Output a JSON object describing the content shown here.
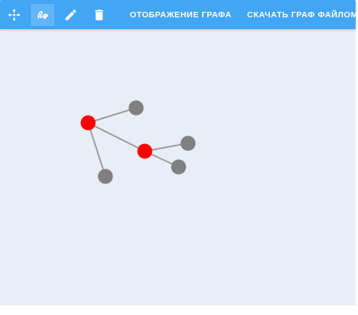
{
  "toolbar": {
    "tools": [
      {
        "icon": "move-icon",
        "active": false
      },
      {
        "icon": "draw-edge-icon",
        "active": true
      },
      {
        "icon": "pencil-icon",
        "active": false
      },
      {
        "icon": "trash-icon",
        "active": false
      }
    ],
    "show_graph_label": "ОТОБРАЖЕНИЕ ГРАФА",
    "download_label": "СКАЧАТЬ ГРАФ ФАЙЛОМ"
  },
  "colors": {
    "toolbar": "#42a5f5",
    "canvas": "#e9eef6",
    "node_selected": "#ff0000",
    "node_default": "#808080",
    "edge": "#9e9e9e"
  },
  "graph": {
    "nodes": [
      {
        "id": "n1",
        "color": "#ff0000"
      },
      {
        "id": "n2",
        "color": "#808080"
      },
      {
        "id": "n3",
        "color": "#808080"
      },
      {
        "id": "n4",
        "color": "#ff0000"
      },
      {
        "id": "n5",
        "color": "#808080"
      },
      {
        "id": "n6",
        "color": "#808080"
      }
    ],
    "edges": [
      {
        "from": "n1",
        "to": "n2"
      },
      {
        "from": "n1",
        "to": "n3"
      },
      {
        "from": "n1",
        "to": "n4"
      },
      {
        "from": "n4",
        "to": "n5"
      },
      {
        "from": "n4",
        "to": "n6"
      }
    ]
  }
}
